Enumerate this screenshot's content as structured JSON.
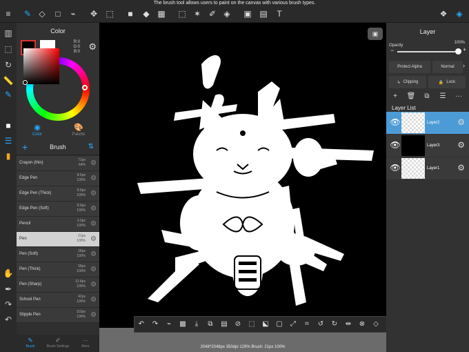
{
  "tip": "The brush tool allows users to paint on the canvas with various brush types.",
  "color_panel": {
    "title": "Color",
    "rgb": [
      "R:0",
      "G:0",
      "B:0"
    ],
    "tabs": [
      "Color",
      "Palette"
    ]
  },
  "brush_panel": {
    "title": "Brush",
    "items": [
      {
        "name": "Crayon (thin)",
        "size": "71px",
        "opacity": "64%"
      },
      {
        "name": "Edge Pen",
        "size": "8.5px",
        "opacity": "100%"
      },
      {
        "name": "Edge Pen (Thick)",
        "size": "8.9px",
        "opacity": "100%"
      },
      {
        "name": "Edge Pen (Soft)",
        "size": "8.9px",
        "opacity": "100%"
      },
      {
        "name": "Pencil",
        "size": "3.0px",
        "opacity": "100%"
      },
      {
        "name": "Pen",
        "size": "21px",
        "opacity": "100%",
        "selected": true
      },
      {
        "name": "Pen (Soft)",
        "size": "28px",
        "opacity": "100%"
      },
      {
        "name": "Pen (Thick)",
        "size": "58px",
        "opacity": "100%"
      },
      {
        "name": "Pen (Sharp)",
        "size": "12.8px",
        "opacity": "100%"
      },
      {
        "name": "School Pen",
        "size": "42px",
        "opacity": "100%"
      },
      {
        "name": "Stipple Pen",
        "size": "110px",
        "opacity": "100%"
      }
    ],
    "footer": [
      "Brush",
      "Brush Settings",
      "More"
    ]
  },
  "layer_panel": {
    "title": "Layer",
    "opacity_label": "Opacity",
    "opacity_value": "100%",
    "opacity_level": 1.0,
    "protect_alpha": "Protect Alpha",
    "blend_mode": "Normal",
    "clipping": "Clipping",
    "lock": "Lock",
    "list_title": "Layer List",
    "layers": [
      {
        "name": "Layer2",
        "selected": true
      },
      {
        "name": "Layer3"
      },
      {
        "name": "Layer1"
      }
    ]
  },
  "status": "2048*2048px 350dpi 129% Brush: 21px 100%",
  "colors": {
    "accent": "#29a9ff",
    "selection": "#4c9bd6",
    "brush_selected": "#d2d2d2"
  }
}
